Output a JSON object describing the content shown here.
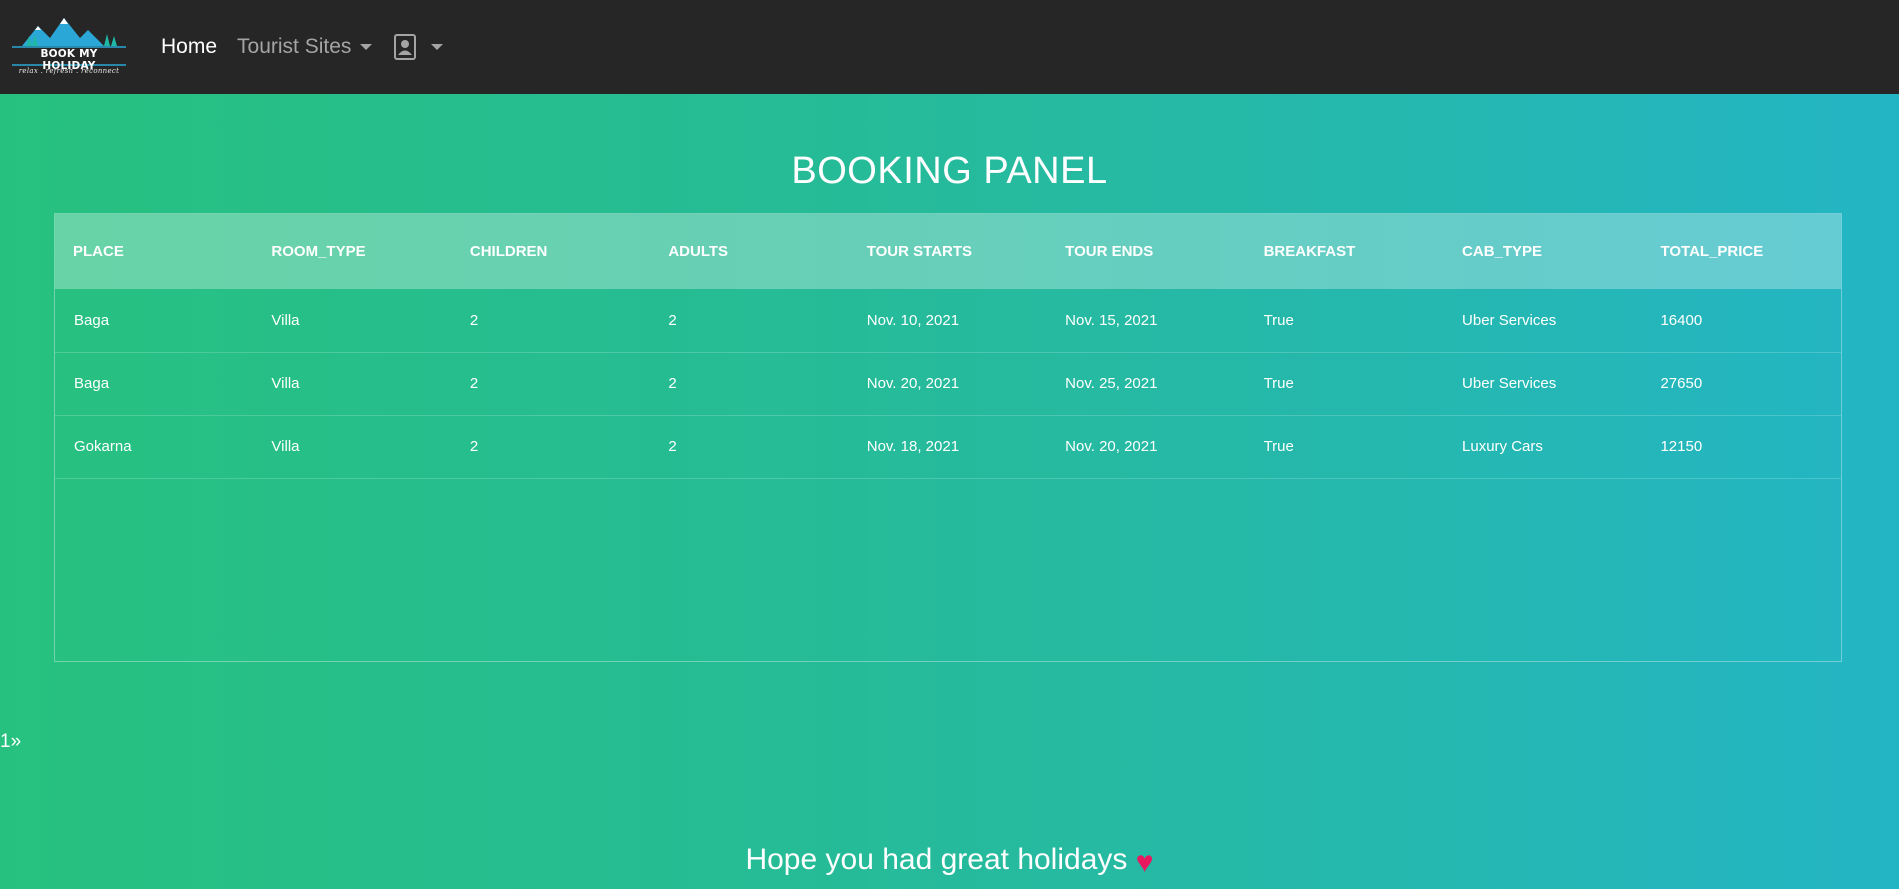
{
  "brand": {
    "name": "BOOK MY HOLIDAY",
    "tagline": "relax . refresh . reconnect"
  },
  "nav": {
    "home": "Home",
    "tourist_sites": "Tourist Sites"
  },
  "colors": {
    "navbar": "#262627",
    "gradient_start": "#27c17f",
    "gradient_end": "#24b5c4",
    "heart": "#e8195f"
  },
  "panel": {
    "title": "BOOKING PANEL"
  },
  "table": {
    "headers": [
      "PLACE",
      "ROOM_TYPE",
      "CHILDREN",
      "ADULTS",
      "TOUR STARTS",
      "TOUR ENDS",
      "BREAKFAST",
      "CAB_TYPE",
      "TOTAL_PRICE"
    ],
    "rows": [
      [
        "Baga",
        "Villa",
        "2",
        "2",
        "Nov. 10, 2021",
        "Nov. 15, 2021",
        "True",
        "Uber Services",
        "16400"
      ],
      [
        "Baga",
        "Villa",
        "2",
        "2",
        "Nov. 20, 2021",
        "Nov. 25, 2021",
        "True",
        "Uber Services",
        "27650"
      ],
      [
        "Gokarna",
        "Villa",
        "2",
        "2",
        "Nov. 18, 2021",
        "Nov. 20, 2021",
        "True",
        "Luxury Cars",
        "12150"
      ]
    ]
  },
  "pagination": {
    "current": "1",
    "next": "»"
  },
  "footer": {
    "message": "Hope you had great holidays",
    "heart": "♥"
  }
}
